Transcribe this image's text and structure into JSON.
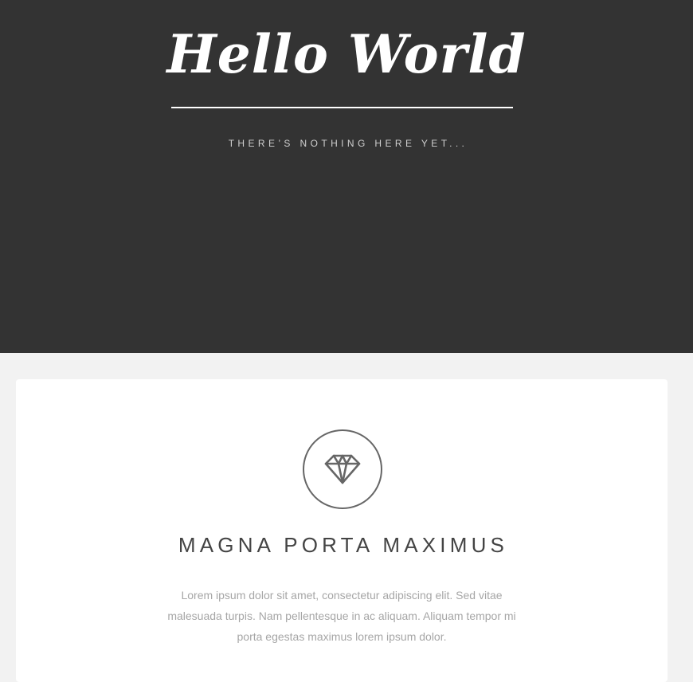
{
  "header": {
    "title": "Hello World",
    "tagline": "THERE’S NOTHING HERE YET..."
  },
  "feature": {
    "icon": "diamond-icon",
    "heading": "MAGNA PORTA MAXIMUS",
    "body": "Lorem ipsum dolor sit amet, consectetur adipiscing elit. Sed vitae malesuada turpis. Nam pellentesque in ac aliquam. Aliquam tempor mi porta egestas maximus lorem ipsum dolor."
  },
  "colors": {
    "header_bg": "#333333",
    "page_bg": "#f2f2f2",
    "card_bg": "#ffffff",
    "heading_text": "#444444",
    "body_text": "#a6a6a6"
  }
}
